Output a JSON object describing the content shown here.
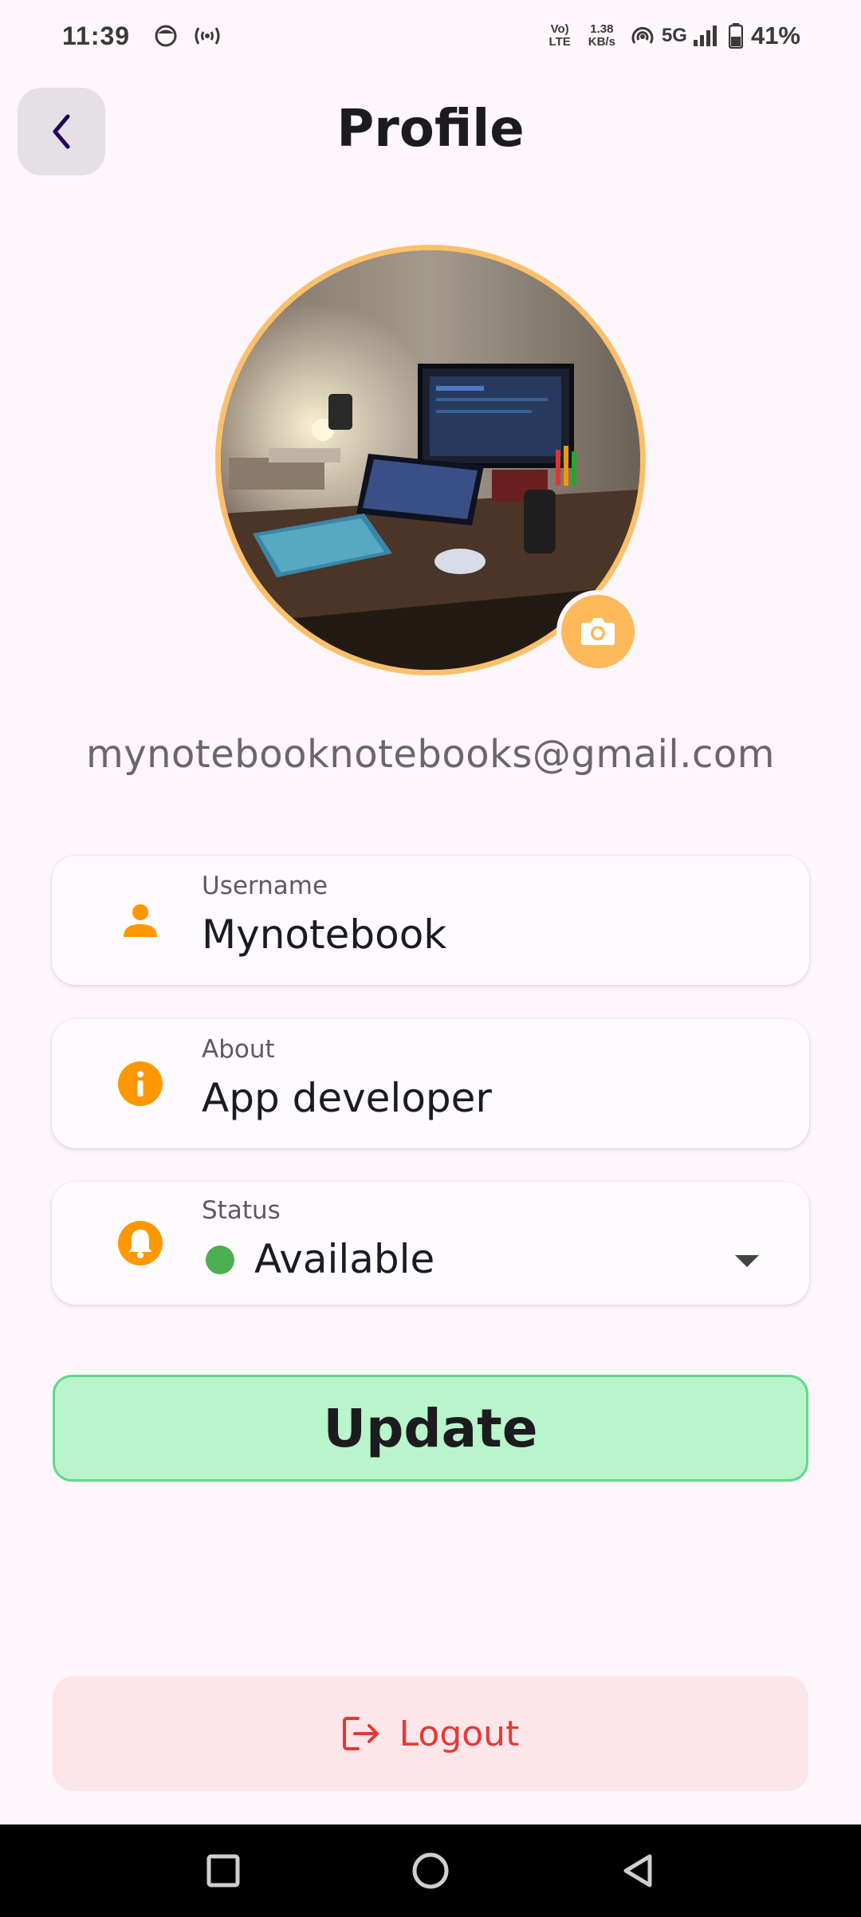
{
  "status_bar": {
    "time": "11:39",
    "network_type_top": "Vo)",
    "network_type_bottom": "LTE",
    "speed_top": "1.38",
    "speed_bottom": "KB/s",
    "signal_label": "5G",
    "battery_percent": "41%",
    "icons": [
      "face-icon",
      "cast-icon",
      "volte-icon",
      "hotspot-icon",
      "signal-icon",
      "battery-icon"
    ]
  },
  "header": {
    "back_icon": "chevron-left-icon",
    "title": "Profile"
  },
  "profile": {
    "avatar_description": "desk-setup-photo",
    "camera_icon": "camera-icon",
    "email": "mynotebooknotebooks@gmail.com"
  },
  "fields": {
    "username": {
      "label": "Username",
      "value": "Mynotebook",
      "icon": "person-icon"
    },
    "about": {
      "label": "About",
      "value": "App developer",
      "icon": "info-icon"
    },
    "status": {
      "label": "Status",
      "value": "Available",
      "icon": "bell-icon",
      "dot_color": "#4caf50"
    }
  },
  "actions": {
    "update_label": "Update",
    "logout_label": "Logout"
  },
  "colors": {
    "accent": "#ff9800",
    "update_bg": "#b8f5ca",
    "logout_text": "#e53935",
    "avatar_ring": "#fbc06c"
  },
  "navbar": {
    "icons": [
      "recents-square-icon",
      "home-circle-icon",
      "back-triangle-icon"
    ]
  }
}
